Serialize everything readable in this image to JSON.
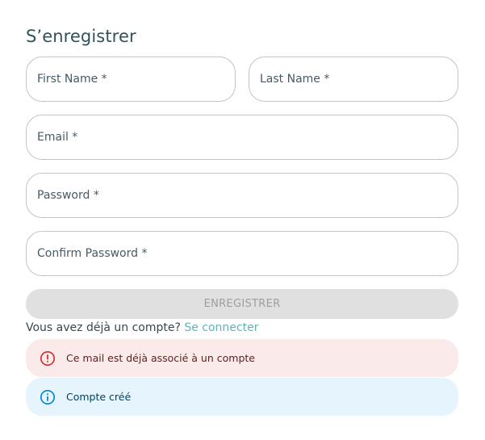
{
  "form": {
    "title": "S’enregistrer",
    "first_name_placeholder": "First Name *",
    "last_name_placeholder": "Last Name *",
    "email_placeholder": "Email *",
    "password_placeholder": "Password *",
    "confirm_password_placeholder": "Confirm Password *",
    "submit_label": "ENREGISTRER",
    "submit_disabled": true
  },
  "login": {
    "prompt": "Vous avez déjà un compte?",
    "link": "Se connecter"
  },
  "alerts": {
    "error": {
      "icon": "error-outline-icon",
      "text": "Ce mail est déjà associé à un compte",
      "bg": "#fbeaea",
      "color": "#d32f2f"
    },
    "info": {
      "icon": "info-outline-icon",
      "text": "Compte créé",
      "bg": "#e5f4fd",
      "color": "#0288d1"
    }
  },
  "colors": {
    "title": "#30525a",
    "link": "#5fb3c1",
    "border": "#c4c4c4",
    "button_disabled_bg": "#e0e0e0",
    "button_disabled_text": "#9e9e9e"
  }
}
